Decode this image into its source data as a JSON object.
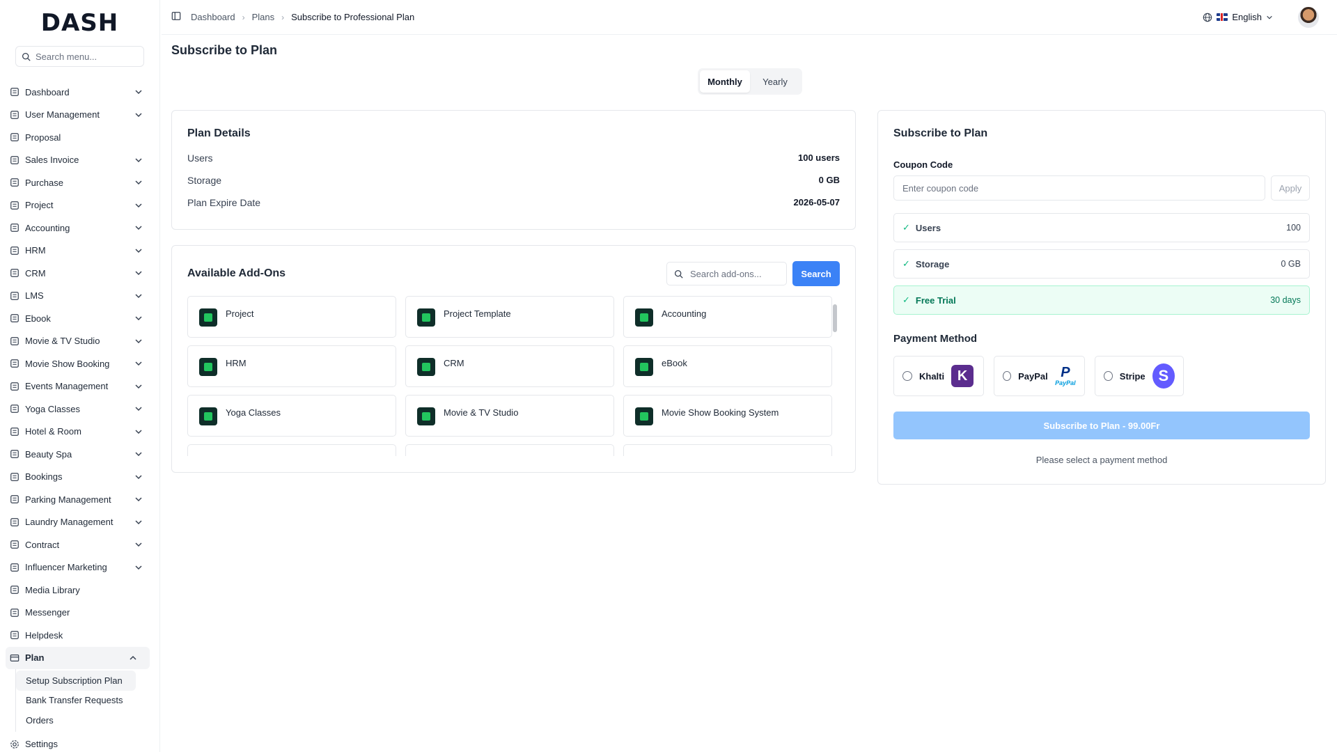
{
  "app": {
    "logo": "DASH"
  },
  "sidebar": {
    "search_placeholder": "Search menu...",
    "items": [
      {
        "label": "Dashboard",
        "icon": "grid-icon",
        "chevron": true
      },
      {
        "label": "User Management",
        "icon": "users-icon",
        "chevron": true
      },
      {
        "label": "Proposal",
        "icon": "proposal-icon",
        "chevron": false
      },
      {
        "label": "Sales Invoice",
        "icon": "invoice-icon",
        "chevron": true
      },
      {
        "label": "Purchase",
        "icon": "cart-icon",
        "chevron": true
      },
      {
        "label": "Project",
        "icon": "folder-icon",
        "chevron": true
      },
      {
        "label": "Accounting",
        "icon": "calculator-icon",
        "chevron": true
      },
      {
        "label": "HRM",
        "icon": "user-cog-icon",
        "chevron": true
      },
      {
        "label": "CRM",
        "icon": "crm-icon",
        "chevron": true
      },
      {
        "label": "LMS",
        "icon": "graduation-cap-icon",
        "chevron": true
      },
      {
        "label": "Ebook",
        "icon": "book-icon",
        "chevron": true
      },
      {
        "label": "Movie & TV Studio",
        "icon": "clapperboard-icon",
        "chevron": true
      },
      {
        "label": "Movie Show Booking",
        "icon": "ticket-icon",
        "chevron": true
      },
      {
        "label": "Events Management",
        "icon": "party-icon",
        "chevron": true
      },
      {
        "label": "Yoga Classes",
        "icon": "sun-icon",
        "chevron": true
      },
      {
        "label": "Hotel & Room",
        "icon": "hotel-icon",
        "chevron": true
      },
      {
        "label": "Beauty Spa",
        "icon": "scissors-icon",
        "chevron": true
      },
      {
        "label": "Bookings",
        "icon": "list-icon",
        "chevron": true
      },
      {
        "label": "Parking Management",
        "icon": "parking-icon",
        "chevron": true
      },
      {
        "label": "Laundry Management",
        "icon": "washer-icon",
        "chevron": true
      },
      {
        "label": "Contract",
        "icon": "contract-icon",
        "chevron": true
      },
      {
        "label": "Influencer Marketing",
        "icon": "crown-icon",
        "chevron": true
      },
      {
        "label": "Media Library",
        "icon": "image-icon",
        "chevron": false
      },
      {
        "label": "Messenger",
        "icon": "message-icon",
        "chevron": false
      },
      {
        "label": "Helpdesk",
        "icon": "headphones-icon",
        "chevron": false
      }
    ],
    "plan": {
      "label": "Plan",
      "sub_items": [
        "Setup Subscription Plan",
        "Bank Transfer Requests",
        "Orders"
      ]
    },
    "settings_label": "Settings"
  },
  "header": {
    "breadcrumb": [
      "Dashboard",
      "Plans",
      "Subscribe to Professional Plan"
    ],
    "language": "English"
  },
  "main": {
    "title": "Subscribe to Plan",
    "billing_toggle": {
      "monthly": "Monthly",
      "yearly": "Yearly",
      "selected": "Monthly"
    },
    "plan_details": {
      "title": "Plan Details",
      "rows": [
        {
          "label": "Users",
          "value": "100 users"
        },
        {
          "label": "Storage",
          "value": "0 GB"
        },
        {
          "label": "Plan Expire Date",
          "value": "2026-05-07"
        }
      ]
    },
    "addons": {
      "title": "Available Add-Ons",
      "search_placeholder": "Search add-ons...",
      "search_button": "Search",
      "items": [
        "Project",
        "Project Template",
        "Accounting",
        "HRM",
        "CRM",
        "eBook",
        "Yoga Classes",
        "Movie & TV Studio",
        "Movie Show Booking System"
      ]
    },
    "subscribe": {
      "title": "Subscribe to Plan",
      "coupon_label": "Coupon Code",
      "coupon_placeholder": "Enter coupon code",
      "apply_label": "Apply",
      "features": [
        {
          "label": "Users",
          "value": "100"
        },
        {
          "label": "Storage",
          "value": "0 GB"
        },
        {
          "label": "Free Trial",
          "value": "30 days"
        }
      ],
      "payment_title": "Payment Method",
      "payment_methods": [
        "Khalti",
        "PayPal",
        "Stripe"
      ],
      "button_label": "Subscribe to Plan - 99.00Fr",
      "note": "Please select a payment method"
    }
  },
  "colors": {
    "primary": "#3b82f6",
    "primary_disabled": "#93c5fd",
    "success": "#10b981",
    "brand_green": "#22c55e"
  }
}
